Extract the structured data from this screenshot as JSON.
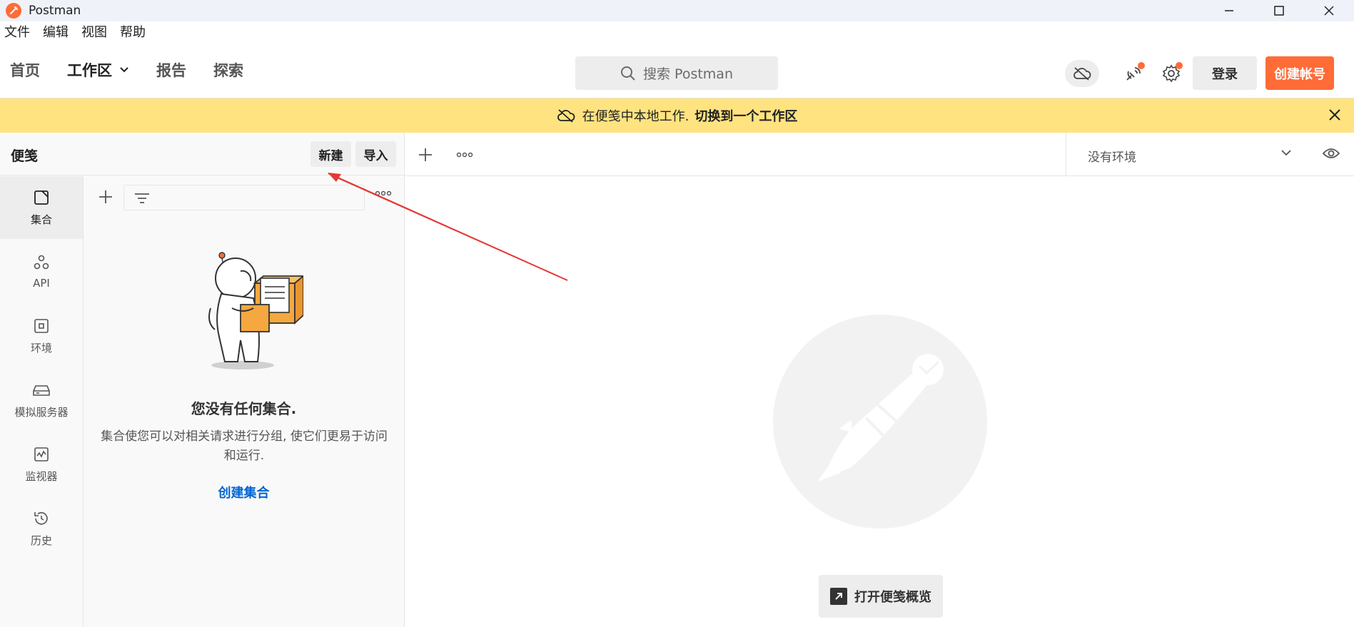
{
  "window": {
    "title": "Postman"
  },
  "menu": [
    "文件",
    "编辑",
    "视图",
    "帮助"
  ],
  "nav": {
    "home": "首页",
    "workspace": "工作区",
    "reports": "报告",
    "explore": "探索"
  },
  "search": {
    "placeholder": "搜索 Postman"
  },
  "header": {
    "login": "登录",
    "signup": "创建帐号"
  },
  "banner": {
    "text": "在便笺中本地工作.",
    "link": "切换到一个工作区"
  },
  "sidebar": {
    "title": "便笺",
    "new_button": "新建",
    "import_button": "导入",
    "rail": [
      {
        "label": "集合",
        "icon": "collection-icon"
      },
      {
        "label": "API",
        "icon": "api-icon"
      },
      {
        "label": "环境",
        "icon": "environment-icon"
      },
      {
        "label": "模拟服务器",
        "icon": "mock-server-icon"
      },
      {
        "label": "监视器",
        "icon": "monitor-icon"
      },
      {
        "label": "历史",
        "icon": "history-icon"
      }
    ]
  },
  "empty_state": {
    "title": "您没有任何集合.",
    "description": "集合使您可以对相关请求进行分组, 使它们更易于访问和运行.",
    "link": "创建集合"
  },
  "main": {
    "environment": "没有环境",
    "overview_button": "打开便笺概览"
  },
  "colors": {
    "brand": "#ff6c37",
    "banner": "#ffe380",
    "link": "#0265d2",
    "annotation": "#e53935"
  }
}
